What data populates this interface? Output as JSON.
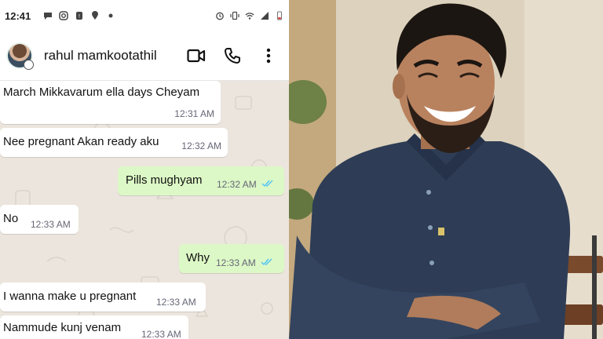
{
  "status_bar": {
    "time": "12:41",
    "left_icons": [
      "chat-bubble-icon",
      "instagram-icon",
      "notification-icon",
      "location-icon",
      "dot-icon"
    ],
    "right_icons": [
      "alarm-icon",
      "vibrate-icon",
      "wifi-icon",
      "signal-icon",
      "battery-low-icon"
    ]
  },
  "chat": {
    "contact_name": "rahul mamkootathil",
    "actions": [
      "video-call-icon",
      "phone-call-icon",
      "more-options-icon"
    ],
    "messages": [
      {
        "direction": "in",
        "text": "March Mikkavarum ella days Cheyam",
        "time": "12:31 AM"
      },
      {
        "direction": "in",
        "text": "Nee pregnant Akan ready aku",
        "time": "12:32 AM"
      },
      {
        "direction": "out",
        "text": "Pills mughyam",
        "time": "12:32 AM",
        "status": "read"
      },
      {
        "direction": "in",
        "text": "No",
        "time": "12:33 AM"
      },
      {
        "direction": "out",
        "text": "Why",
        "time": "12:33 AM",
        "status": "read"
      },
      {
        "direction": "in",
        "text": "I wanna make u pregnant",
        "time": "12:33 AM"
      },
      {
        "direction": "in",
        "text": "Nammude kunj venam",
        "time": "12:33 AM"
      }
    ]
  },
  "colors": {
    "incoming_bubble": "#ffffff",
    "outgoing_bubble": "#dcf8c6",
    "chat_background": "#ece5dd",
    "read_ticks": "#4fc3f7",
    "shirt": "#2e3d55"
  }
}
